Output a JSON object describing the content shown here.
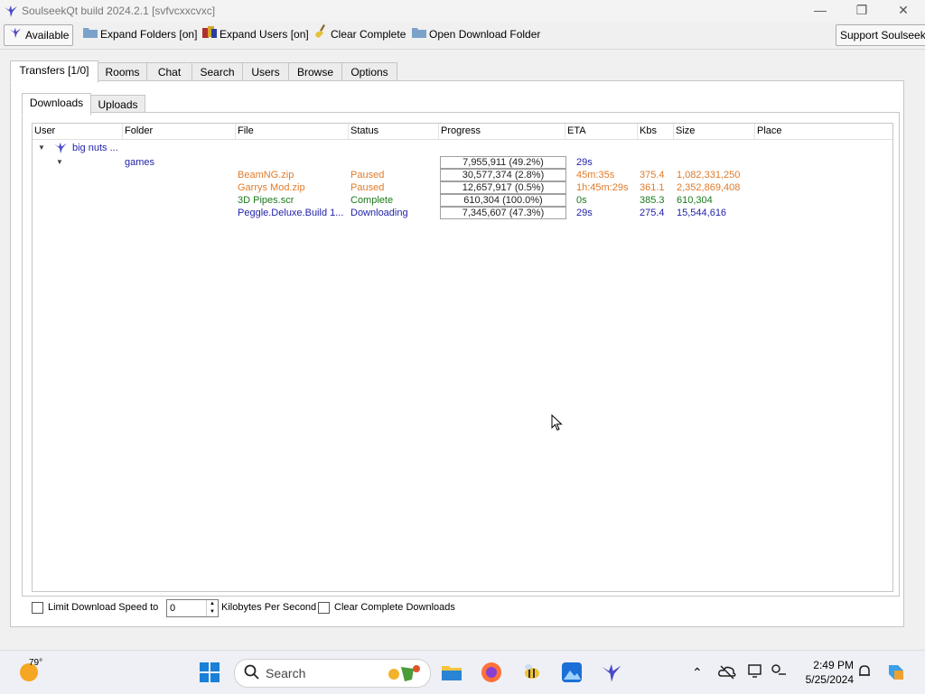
{
  "window": {
    "title": "SoulseekQt build 2024.2.1 [svfvcxxcvxc]"
  },
  "toolbar": {
    "available_label": "Available",
    "expand_folders_label": "Expand Folders [on]",
    "expand_users_label": "Expand Users [on]",
    "clear_complete_label": "Clear Complete",
    "open_download_folder_label": "Open Download Folder",
    "support_label": "Support Soulseek!"
  },
  "main_tabs": [
    "Transfers [1/0]",
    "Rooms",
    "Chat",
    "Search",
    "Users",
    "Browse",
    "Options"
  ],
  "sub_tabs": [
    "Downloads",
    "Uploads"
  ],
  "columns": [
    "User",
    "Folder",
    "File",
    "Status",
    "Progress",
    "ETA",
    "Kbs",
    "Size",
    "Place"
  ],
  "tree": {
    "user": "big nuts ...",
    "folder": "games",
    "folder_progress": "7,955,911 (49.2%)",
    "folder_progress_fraction": 0.492,
    "folder_eta": "29s"
  },
  "files": [
    {
      "file": "BeamNG.zip",
      "status": "Paused",
      "progress": "30,577,374 (2.8%)",
      "progress_fraction": 0.028,
      "eta": "45m:35s",
      "kbs": "375.4",
      "size": "1,082,331,250",
      "color": "#e07b2b"
    },
    {
      "file": "Garrys Mod.zip",
      "status": "Paused",
      "progress": "12,657,917 (0.5%)",
      "progress_fraction": 0.005,
      "eta": "1h:45m:29s",
      "kbs": "361.1",
      "size": "2,352,869,408",
      "color": "#e07b2b"
    },
    {
      "file": "3D Pipes.scr",
      "status": "Complete",
      "progress": "610,304 (100.0%)",
      "progress_fraction": 1.0,
      "eta": "0s",
      "kbs": "385.3",
      "size": "610,304",
      "color": "#1a7a1a"
    },
    {
      "file": "Peggle.Deluxe.Build 1...",
      "status": "Downloading",
      "progress": "7,345,607 (47.3%)",
      "progress_fraction": 0.473,
      "eta": "29s",
      "kbs": "275.4",
      "size": "15,544,616",
      "color": "#1f1fa8"
    }
  ],
  "bottom": {
    "limit_label": "Limit Download Speed to",
    "speed_value": "0",
    "unit_label": "Kilobytes Per Second",
    "clear_label": "Clear Complete Downloads"
  },
  "taskbar": {
    "weather_temp": "79°",
    "search_placeholder": "Search",
    "time": "2:49 PM",
    "date": "5/25/2024"
  },
  "colors": {
    "link_blue": "#1f1fa8",
    "paused_orange": "#e07b2b",
    "complete_green": "#1a7a1a"
  }
}
